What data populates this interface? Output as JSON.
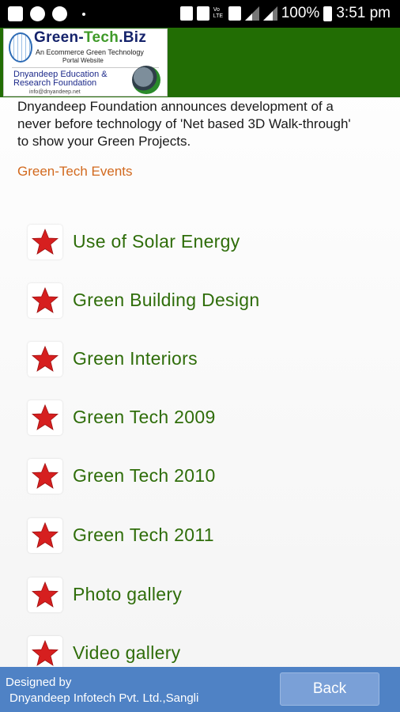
{
  "status_bar": {
    "battery": "100%",
    "time": "3:51 pm",
    "volte": "Vo LTE"
  },
  "header": {
    "logo": {
      "title_main": "Green-",
      "title_tech": "Tech",
      "title_end": ".Biz",
      "subtitle1": "An Ecommerce Green Technology",
      "subtitle2": "Portal Website",
      "foundation_line1": "Dnyandeep Education &",
      "foundation_line2": "Research Foundation",
      "email": "info@dnyandeep.net"
    }
  },
  "intro": {
    "line1": "Dnyandeep Foundation announces development of a",
    "line2": "never before technology of 'Net based 3D Walk-through'",
    "line3": "to show your Green Projects."
  },
  "events_link": "Green-Tech Events",
  "menu": [
    {
      "label": "Use of Solar Energy"
    },
    {
      "label": "Green Building Design"
    },
    {
      "label": "Green Interiors"
    },
    {
      "label": "Green Tech 2009"
    },
    {
      "label": "Green Tech 2010"
    },
    {
      "label": "Green Tech 2011"
    },
    {
      "label": "Photo gallery"
    },
    {
      "label": "Video gallery"
    }
  ],
  "footer": {
    "designed_by": "Designed by",
    "company": "Dnyandeep Infotech Pvt. Ltd.,Sangli",
    "back_label": "Back"
  },
  "colors": {
    "header_green": "#226d04",
    "label_green": "#2f6d0a",
    "link_orange": "#d2691e",
    "footer_blue": "#4f82c5",
    "star_red": "#d61f1f"
  }
}
